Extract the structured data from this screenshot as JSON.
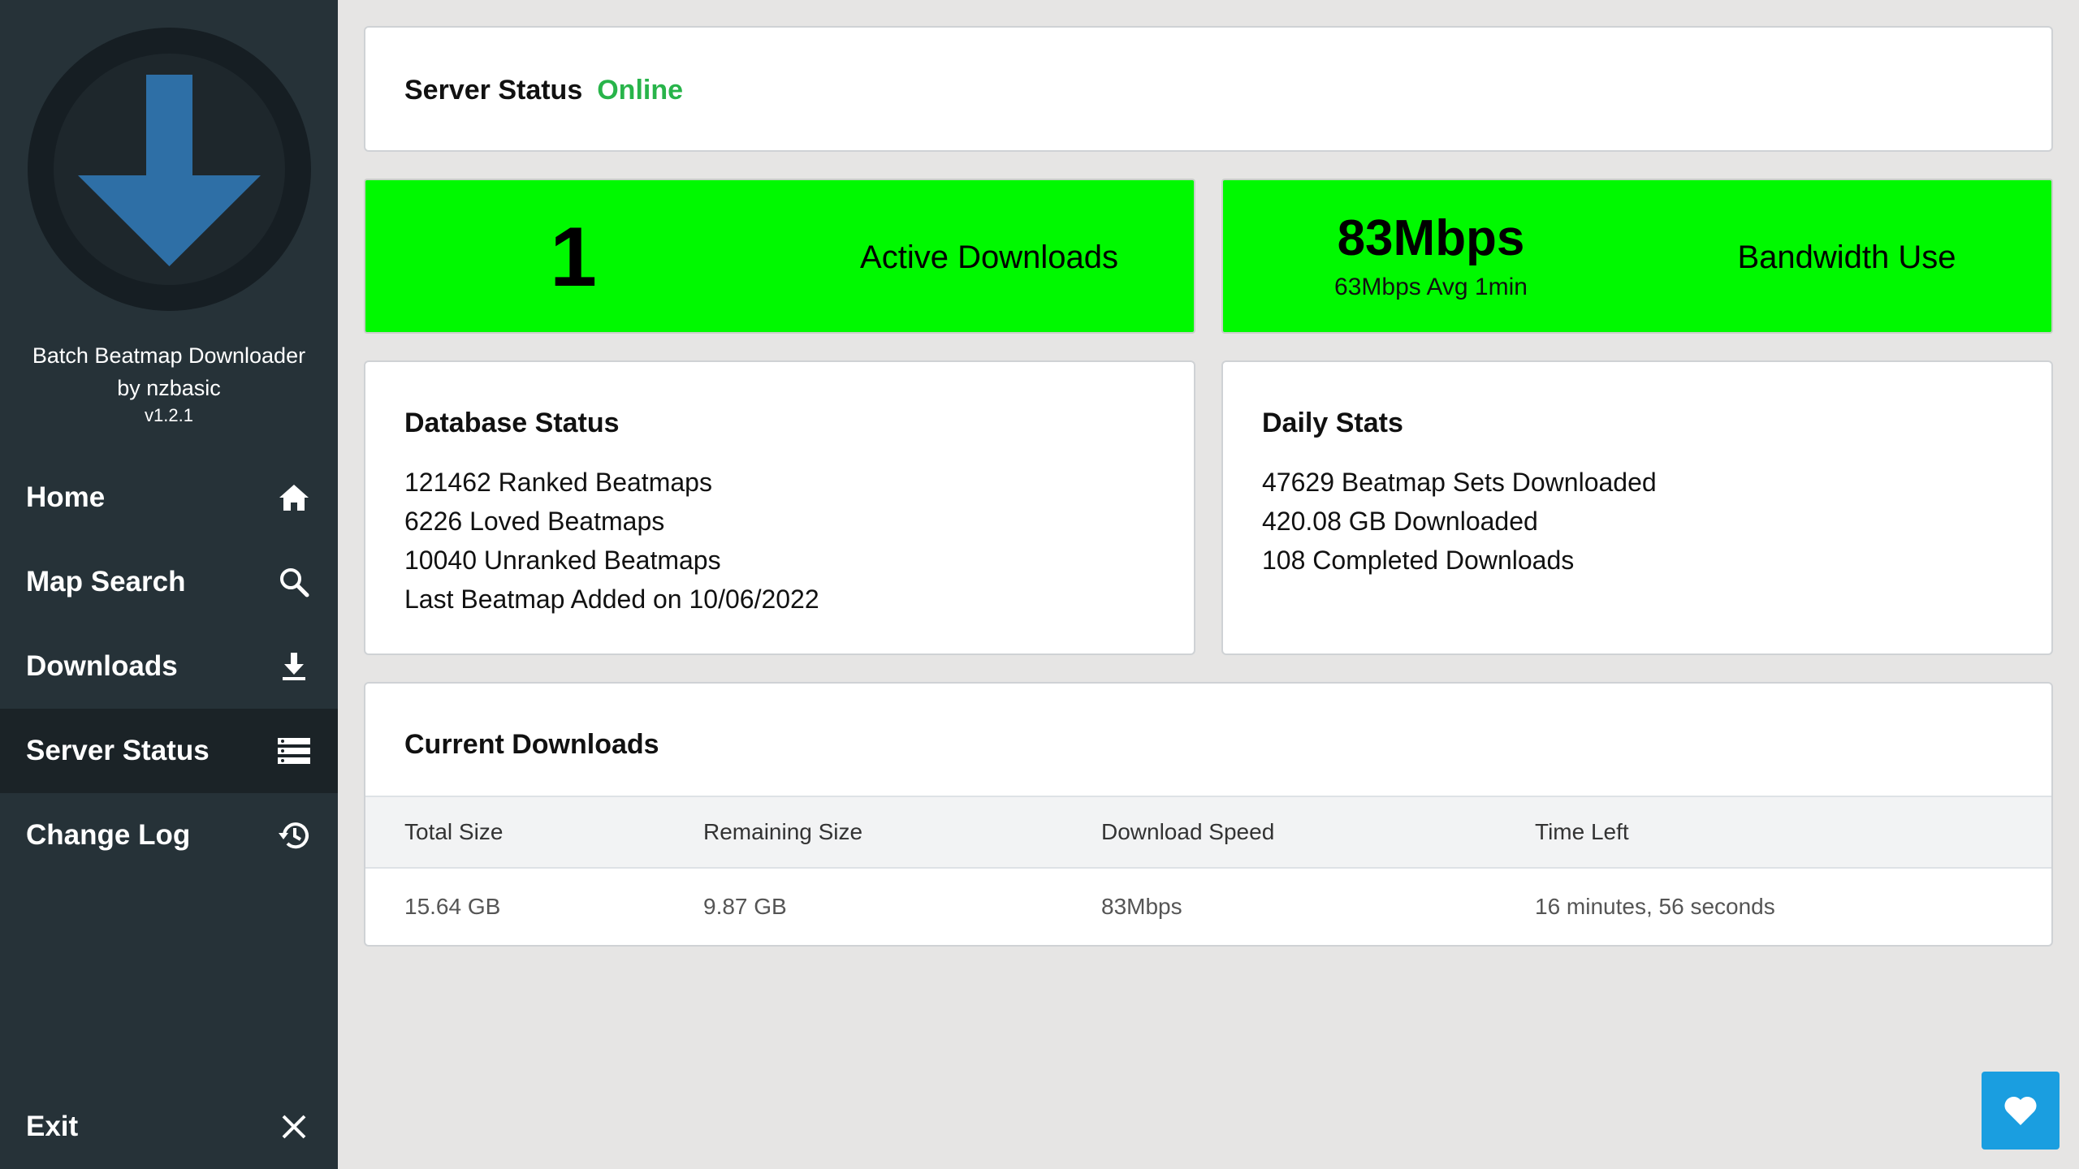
{
  "sidebar": {
    "app_name_line1": "Batch Beatmap Downloader",
    "app_name_line2": "by nzbasic",
    "version": "v1.2.1",
    "items": [
      {
        "label": "Home",
        "icon": "home-icon"
      },
      {
        "label": "Map Search",
        "icon": "search-icon"
      },
      {
        "label": "Downloads",
        "icon": "download-icon"
      },
      {
        "label": "Server Status",
        "icon": "server-icon",
        "active": true
      },
      {
        "label": "Change Log",
        "icon": "history-icon"
      }
    ],
    "exit": {
      "label": "Exit",
      "icon": "close-icon"
    }
  },
  "server_status": {
    "label": "Server Status",
    "value": "Online",
    "value_color": "#28b44a"
  },
  "active_downloads": {
    "count": "1",
    "label": "Active Downloads"
  },
  "bandwidth": {
    "current": "83Mbps",
    "average": "63Mbps Avg 1min",
    "label": "Bandwidth Use"
  },
  "database_status": {
    "title": "Database Status",
    "lines": [
      "121462 Ranked Beatmaps",
      "6226 Loved Beatmaps",
      "10040 Unranked Beatmaps",
      "Last Beatmap Added on 10/06/2022"
    ]
  },
  "daily_stats": {
    "title": "Daily Stats",
    "lines": [
      "47629 Beatmap Sets Downloaded",
      "420.08 GB Downloaded",
      "108 Completed Downloads"
    ]
  },
  "current_downloads": {
    "title": "Current Downloads",
    "columns": [
      "Total Size",
      "Remaining Size",
      "Download Speed",
      "Time Left"
    ],
    "rows": [
      [
        "15.64 GB",
        "9.87 GB",
        "83Mbps",
        "16 minutes, 56 seconds"
      ]
    ]
  },
  "colors": {
    "sidebar_bg": "#263238",
    "highlight_green": "#00f900",
    "accent_blue": "#1a9ee0",
    "logo_arrow": "#2e6fa6"
  }
}
